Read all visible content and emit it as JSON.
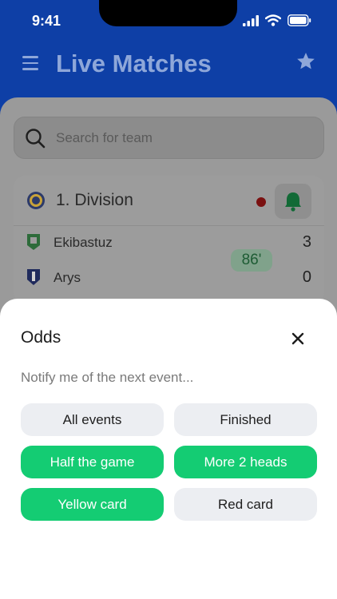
{
  "status_bar": {
    "time": "9:41"
  },
  "header": {
    "title": "Live Matches"
  },
  "search": {
    "placeholder": "Search for team"
  },
  "match": {
    "league": "1. Division",
    "home": {
      "name": "Ekibastuz",
      "score": "3"
    },
    "away": {
      "name": "Arys",
      "score": "0"
    },
    "minute": "86'"
  },
  "sheet": {
    "title": "Odds",
    "subtitle": "Notify me of the next event...",
    "options": [
      {
        "label": "All events",
        "selected": false
      },
      {
        "label": "Finished",
        "selected": false
      },
      {
        "label": "Half the game",
        "selected": true
      },
      {
        "label": "More 2 heads",
        "selected": true
      },
      {
        "label": "Yellow card",
        "selected": true
      },
      {
        "label": "Red card",
        "selected": false
      }
    ]
  },
  "colors": {
    "header_blue": "#0e3fa6",
    "accent_green": "#14cc73",
    "option_grey": "#eceef2",
    "live_red": "#c40000"
  },
  "icons": [
    "menu-icon",
    "star-icon",
    "search-icon",
    "bell-icon",
    "close-icon",
    "signal-icon",
    "wifi-icon",
    "battery-icon"
  ]
}
